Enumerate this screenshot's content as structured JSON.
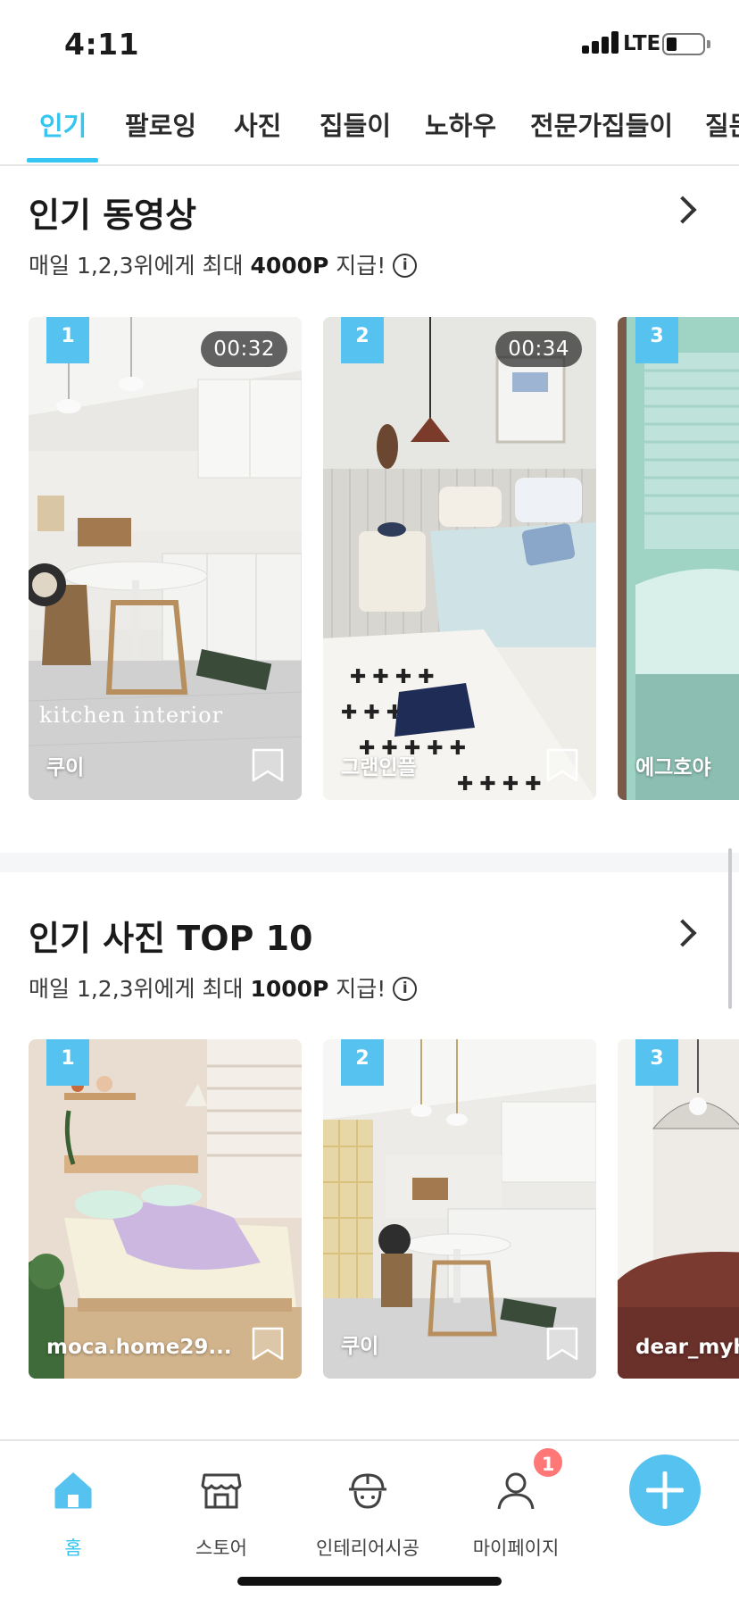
{
  "status_bar": {
    "time": "4:11",
    "network": "LTE"
  },
  "tabs": [
    {
      "label": "인기",
      "active": true
    },
    {
      "label": "팔로잉"
    },
    {
      "label": "사진"
    },
    {
      "label": "집들이"
    },
    {
      "label": "노하우"
    },
    {
      "label": "전문가집들이"
    },
    {
      "label": "질문"
    }
  ],
  "videos_section": {
    "title": "인기 동영상",
    "subtitle_prefix": "매일 1,2,3위에게 최대 ",
    "subtitle_points": "4000P",
    "subtitle_suffix": " 지급!",
    "info_icon": "i",
    "cards": [
      {
        "rank": "1",
        "duration": "00:32",
        "user": "쿠이",
        "overlay": "kitchen interior"
      },
      {
        "rank": "2",
        "duration": "00:34",
        "user": "그랜인플"
      },
      {
        "rank": "3",
        "user": "에그호야"
      }
    ]
  },
  "photos_section": {
    "title": "인기 사진 TOP 10",
    "subtitle_prefix": "매일 1,2,3위에게 최대 ",
    "subtitle_points": "1000P",
    "subtitle_suffix": " 지급!",
    "info_icon": "i",
    "cards": [
      {
        "rank": "1",
        "user": "moca.home29..."
      },
      {
        "rank": "2",
        "user": "쿠이"
      },
      {
        "rank": "3",
        "user": "dear_myh"
      }
    ]
  },
  "bottom_nav": {
    "items": [
      {
        "label": "홈",
        "icon": "home-icon",
        "active": true
      },
      {
        "label": "스토어",
        "icon": "store-icon"
      },
      {
        "label": "인테리어시공",
        "icon": "worker-icon"
      },
      {
        "label": "마이페이지",
        "icon": "person-icon"
      }
    ],
    "notification_count": "1",
    "fab_icon": "plus-icon"
  },
  "colors": {
    "accent": "#35c5f0",
    "badge": "#56c2ef",
    "notification": "#ff7777"
  }
}
